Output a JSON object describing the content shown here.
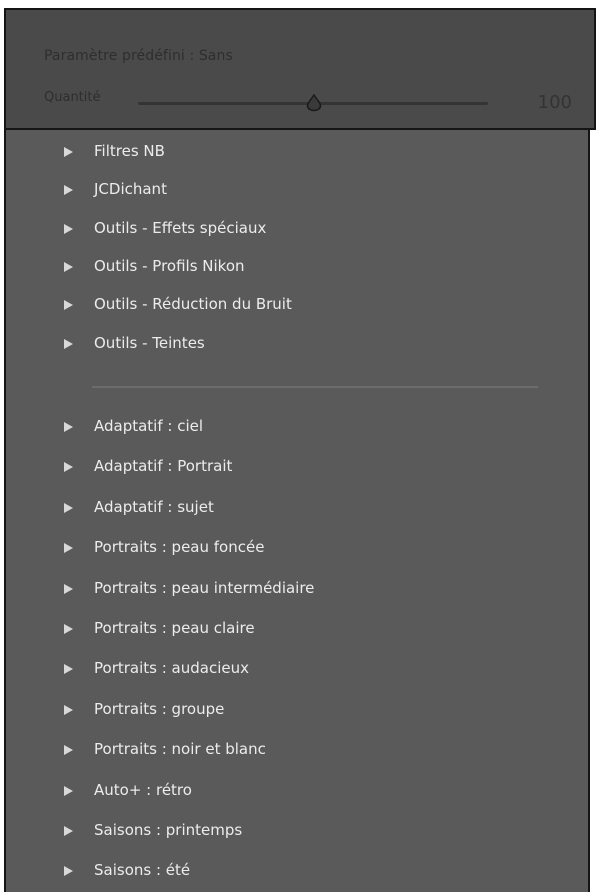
{
  "preset": {
    "label": "Paramètre prédéfini : Sans",
    "amount_label": "Quantité",
    "amount_value": "100",
    "slider_fraction": 0.5
  },
  "groups_top": [
    {
      "label": "Filtres NB"
    },
    {
      "label": "JCDichant"
    },
    {
      "label": "Outils - Effets spéciaux"
    },
    {
      "label": "Outils - Profils Nikon"
    },
    {
      "label": "Outils - Réduction du Bruit"
    },
    {
      "label": "Outils - Teintes"
    }
  ],
  "groups_bottom": [
    {
      "label": "Adaptatif : ciel"
    },
    {
      "label": "Adaptatif : Portrait"
    },
    {
      "label": "Adaptatif : sujet"
    },
    {
      "label": "Portraits : peau foncée"
    },
    {
      "label": "Portraits : peau intermédiaire"
    },
    {
      "label": "Portraits : peau claire"
    },
    {
      "label": "Portraits : audacieux"
    },
    {
      "label": "Portraits : groupe"
    },
    {
      "label": "Portraits : noir et blanc"
    },
    {
      "label": "Auto+ : rétro"
    },
    {
      "label": "Saisons : printemps"
    },
    {
      "label": "Saisons : été"
    }
  ],
  "icons": {
    "expand": "disclosure-triangle-right-icon",
    "slider_knob": "slider-knob-icon"
  },
  "colors": {
    "panel_bg": "#5a5a5a",
    "header_bg": "#4a4a4a",
    "text": "#ececec",
    "arrow": "#d8d8d8"
  }
}
